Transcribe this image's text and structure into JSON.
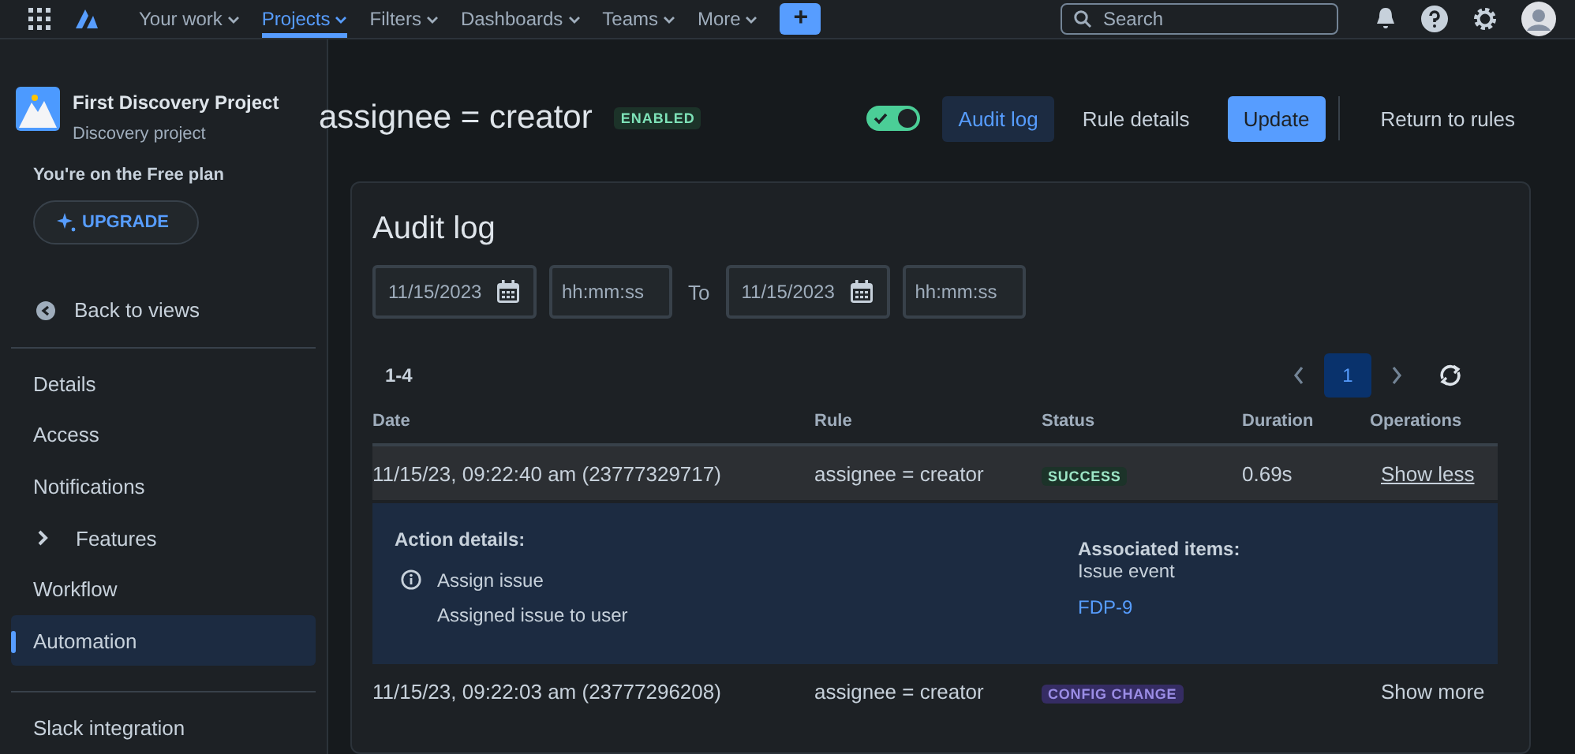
{
  "top_nav": {
    "items": [
      {
        "label": "Your work",
        "selected": false
      },
      {
        "label": "Projects",
        "selected": true
      },
      {
        "label": "Filters",
        "selected": false
      },
      {
        "label": "Dashboards",
        "selected": false
      },
      {
        "label": "Teams",
        "selected": false
      },
      {
        "label": "More",
        "selected": false
      }
    ],
    "create_button": "+",
    "search": {
      "placeholder": "Search"
    }
  },
  "sidebar": {
    "project": {
      "name": "First Discovery Project",
      "type": "Discovery project"
    },
    "plan_text": "You're on the Free plan",
    "upgrade_button": "UPGRADE",
    "back_link": "Back to views",
    "items": [
      {
        "label": "Details",
        "kind": "link",
        "selected": false
      },
      {
        "label": "Access",
        "kind": "link",
        "selected": false
      },
      {
        "label": "Notifications",
        "kind": "link",
        "selected": false
      },
      {
        "label": "Features",
        "kind": "expandable",
        "selected": false,
        "expanded": false
      },
      {
        "label": "Workflow",
        "kind": "link",
        "selected": false
      },
      {
        "label": "Automation",
        "kind": "link",
        "selected": true
      }
    ],
    "footer_items": [
      {
        "label": "Slack integration"
      }
    ]
  },
  "header": {
    "rule_title": "assignee = creator",
    "status_badge": "ENABLED",
    "toggle": {
      "on": true
    },
    "tabs": [
      {
        "label": "Audit log",
        "selected": true
      },
      {
        "label": "Rule details",
        "selected": false
      }
    ],
    "update_button": "Update",
    "return_button": "Return to rules"
  },
  "audit": {
    "title": "Audit log",
    "from_date": "11/15/2023",
    "from_time": {
      "placeholder": "hh:mm:ss"
    },
    "to_label": "To",
    "to_date": "11/15/2023",
    "to_time": {
      "placeholder": "hh:mm:ss"
    },
    "range": "1-4",
    "pages": [
      {
        "label": "1",
        "selected": true
      }
    ],
    "columns": [
      "Date",
      "Rule",
      "Status",
      "Duration",
      "Operations"
    ],
    "rows": [
      {
        "date": "11/15/23, 09:22:40 am (23777329717)",
        "rule": "assignee = creator",
        "status": "SUCCESS",
        "color": "#1c3329",
        "duration": "0.69s",
        "operation": "Show less",
        "expanded": true,
        "details": {
          "title": "Action details:",
          "action": "Assign issue",
          "action_description": "Assigned issue to user",
          "associated_title": "Associated items:",
          "associated_type": "Issue event",
          "issue_link": "FDP-9"
        }
      },
      {
        "date": "11/15/23, 09:22:03 am (23777296208)",
        "rule": "assignee = creator",
        "status": "CONFIG CHANGE",
        "color": "#352c63",
        "operation": "Show more",
        "expanded": false
      }
    ]
  }
}
